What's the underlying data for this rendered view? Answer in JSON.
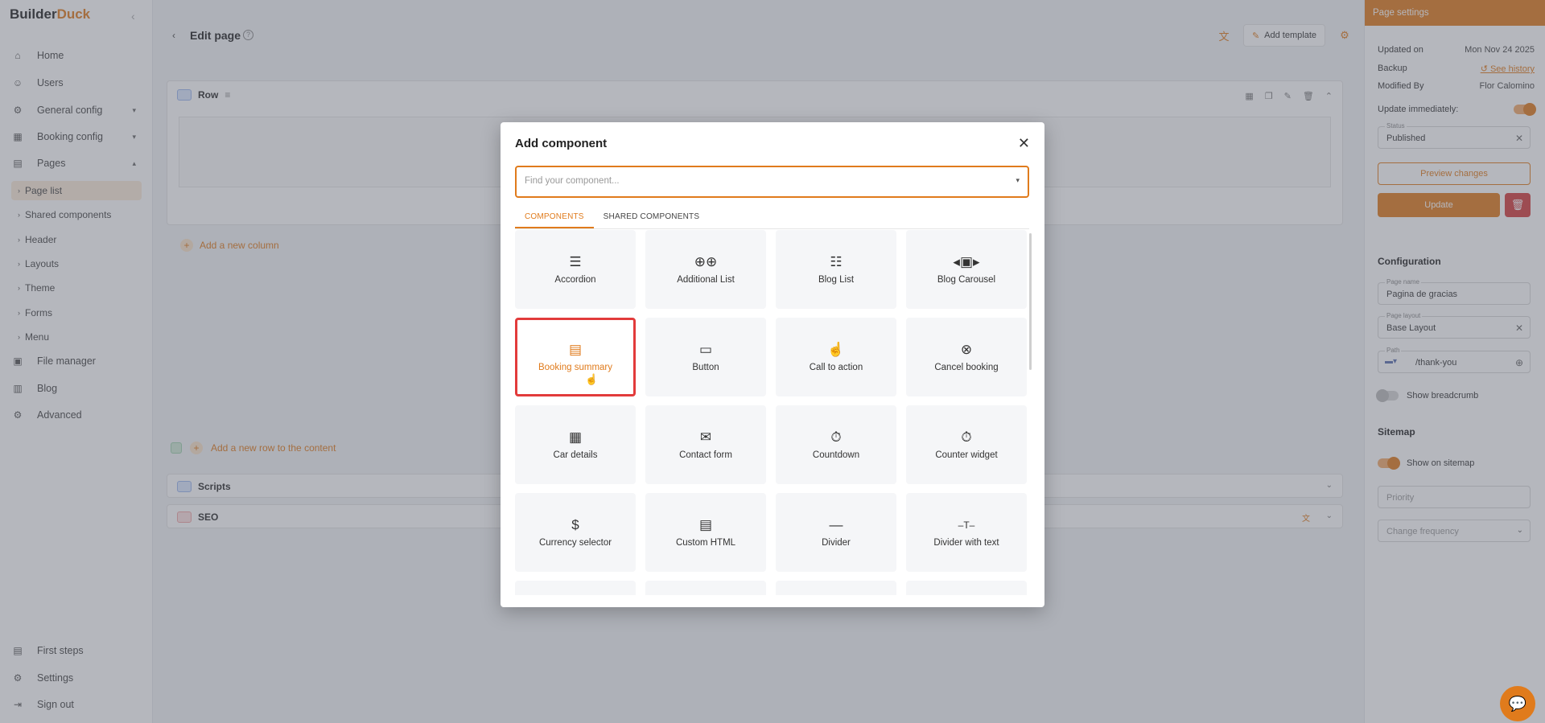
{
  "brand": {
    "part1": "Builder",
    "part2": "Duck"
  },
  "sidebar": {
    "items": [
      {
        "label": "Home",
        "icon": "home-icon",
        "glyph": "⌂"
      },
      {
        "label": "Users",
        "icon": "users-icon",
        "glyph": "👥"
      },
      {
        "label": "General config",
        "icon": "gear-icon",
        "glyph": "⚙"
      },
      {
        "label": "Booking config",
        "icon": "calendar-icon",
        "glyph": "▦"
      },
      {
        "label": "Pages",
        "icon": "pages-icon",
        "glyph": "▤"
      }
    ],
    "sub_items": [
      "Page list",
      "Shared components",
      "Header",
      "Layouts",
      "Theme",
      "Forms",
      "Menu"
    ],
    "bottom_items": [
      {
        "label": "File manager",
        "icon": "file-icon",
        "glyph": "▣"
      },
      {
        "label": "Blog",
        "icon": "blog-icon",
        "glyph": "▥"
      },
      {
        "label": "Advanced",
        "icon": "advanced-gear-icon",
        "glyph": "⚙"
      }
    ],
    "footer_items": [
      {
        "label": "First steps",
        "icon": "book-icon",
        "glyph": "▤"
      },
      {
        "label": "Settings",
        "icon": "settings-icon",
        "glyph": "⚙"
      },
      {
        "label": "Sign out",
        "icon": "sign-out-icon",
        "glyph": "⇥"
      }
    ]
  },
  "header": {
    "title": "Edit page",
    "add_template": "Add template"
  },
  "content": {
    "row_label": "Row",
    "add_column": "Add a new column",
    "add_row": "Add a new row to the content",
    "scripts_label": "Scripts",
    "seo_label": "SEO"
  },
  "settings": {
    "title": "Page settings",
    "updated_on_label": "Updated on",
    "updated_on_value": "Mon Nov 24 2025",
    "backup_label": "Backup",
    "backup_link": "See history",
    "modified_by_label": "Modified By",
    "modified_by_value": "Flor Calomino",
    "update_immediately": "Update immediately:",
    "status_label": "Status",
    "status_value": "Published",
    "preview_btn": "Preview changes",
    "update_btn": "Update",
    "configuration_title": "Configuration",
    "page_name_label": "Page name",
    "page_name_value": "Pagina de gracias",
    "page_layout_label": "Page layout",
    "page_layout_value": "Base Layout",
    "path_label": "Path",
    "path_value": "/thank-you",
    "show_breadcrumb": "Show breadcrumb",
    "sitemap_title": "Sitemap",
    "show_on_sitemap": "Show on sitemap",
    "priority_placeholder": "Priority",
    "change_frequency": "Change frequency"
  },
  "modal": {
    "title": "Add component",
    "search_placeholder": "Find your component...",
    "tabs": [
      "COMPONENTS",
      "SHARED COMPONENTS"
    ],
    "components": [
      {
        "label": "Accordion",
        "icon": "accordion-icon",
        "glyph": "☰"
      },
      {
        "label": "Additional List",
        "icon": "additional-list-icon",
        "glyph": "⊕⊕"
      },
      {
        "label": "Blog List",
        "icon": "blog-list-icon",
        "glyph": "☷"
      },
      {
        "label": "Blog Carousel",
        "icon": "blog-carousel-icon",
        "glyph": "◂▣▸"
      },
      {
        "label": "Booking summary",
        "icon": "booking-summary-icon",
        "glyph": "▤"
      },
      {
        "label": "Button",
        "icon": "button-icon",
        "glyph": "▭"
      },
      {
        "label": "Call to action",
        "icon": "call-to-action-icon",
        "glyph": "☝"
      },
      {
        "label": "Cancel booking",
        "icon": "cancel-booking-icon",
        "glyph": "⊗"
      },
      {
        "label": "Car details",
        "icon": "car-details-icon",
        "glyph": "▦"
      },
      {
        "label": "Contact form",
        "icon": "contact-form-icon",
        "glyph": "✉"
      },
      {
        "label": "Countdown",
        "icon": "countdown-icon",
        "glyph": "⏱"
      },
      {
        "label": "Counter widget",
        "icon": "counter-widget-icon",
        "glyph": "⏱"
      },
      {
        "label": "Currency selector",
        "icon": "currency-selector-icon",
        "glyph": "$"
      },
      {
        "label": "Custom HTML",
        "icon": "custom-html-icon",
        "glyph": "▤"
      },
      {
        "label": "Divider",
        "icon": "divider-icon",
        "glyph": "—"
      },
      {
        "label": "Divider with text",
        "icon": "divider-text-icon",
        "glyph": "–T–"
      }
    ]
  },
  "colors": {
    "accent": "#e07b1c",
    "danger": "#d43d3d",
    "selection": "#e23b3b"
  }
}
